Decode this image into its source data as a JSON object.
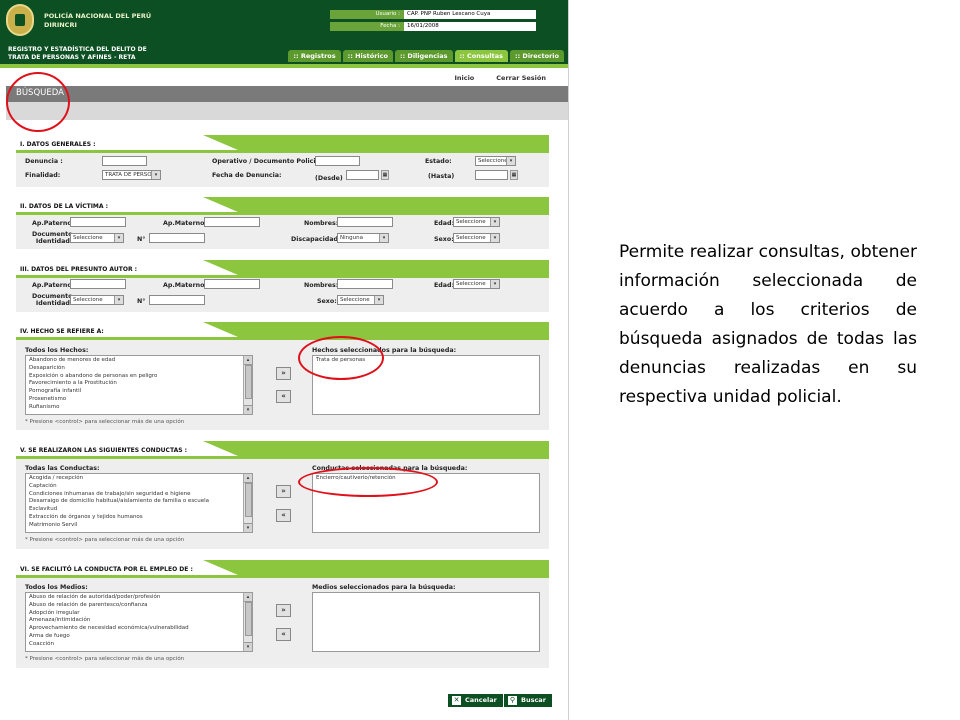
{
  "header": {
    "org_line1": "POLICÍA NACIONAL DEL PERÚ",
    "org_line2": "DIRINCRI",
    "user_label": "Usuario :",
    "user_value": "CAP. PNP Ruben Lescano Cuya",
    "date_label": "Fecha :",
    "date_value": "16/01/2008"
  },
  "module": {
    "title_line1": "REGISTRO Y ESTADÍSTICA DEL DELITO DE",
    "title_line2": "TRATA DE PERSONAS Y AFINES - RETA"
  },
  "nav": {
    "tabs": [
      ":: Registros",
      ":: Histórico",
      ":: Diligencias",
      ":: Consultas",
      ":: Directorio"
    ],
    "active_tab": ":: Consultas",
    "inicio": "Inicio",
    "cerrar": "Cerrar Sesión"
  },
  "page_title": "BÚSQUEDA",
  "sec1": {
    "title": "I. DATOS GENERALES :",
    "denuncia_label": "Denuncia :",
    "operativo_label": "Operativo / Documento Policial:",
    "estado_label": "Estado:",
    "estado_value": "Seleccione",
    "finalidad_label": "Finalidad:",
    "finalidad_value": "TRATA DE PERSO",
    "fecha_label": "Fecha de Denuncia:",
    "desde_label": "(Desde)",
    "hasta_label": "(Hasta)"
  },
  "sec2": {
    "title": "II. DATOS DE LA VÍCTIMA :",
    "ap_paterno": "Ap.Paterno:",
    "ap_materno": "Ap.Materno:",
    "nombres": "Nombres:",
    "edad": "Edad:",
    "edad_value": "Seleccione",
    "doc_line1": "Documento",
    "doc_line2": "Identidad:",
    "doc_value": "Seleccione",
    "numero": "N°",
    "discapacidad": "Discapacidad:",
    "discapacidad_value": "Ninguna",
    "sexo": "Sexo:",
    "sexo_value": "Seleccione"
  },
  "sec3": {
    "title": "III. DATOS DEL PRESUNTO AUTOR :",
    "ap_paterno": "Ap.Paterno:",
    "ap_materno": "Ap.Materno:",
    "nombres": "Nombres:",
    "edad": "Edad:",
    "edad_value": "Seleccione",
    "doc_line1": "Documento",
    "doc_line2": "Identidad:",
    "doc_value": "Seleccione",
    "numero": "N°",
    "sexo": "Sexo:",
    "sexo_value": "Seleccione"
  },
  "sec4": {
    "title": "IV. HECHO SE REFIERE A:",
    "all_label": "Todos los Hechos:",
    "selected_label": "Hechos seleccionados para la búsqueda:",
    "items": [
      "Abandono de menores de edad",
      "Desaparición",
      "Exposición o abandono de personas en peligro",
      "Favorecimiento a la Prostitución",
      "Pornografía infantil",
      "Proxenetismo",
      "Rufianismo"
    ],
    "selected_items": [
      "Trata de personas"
    ],
    "note": "* Presione <control> para seleccionar más de una opción"
  },
  "sec5": {
    "title": "V. SE REALIZARON LAS SIGUIENTES CONDUCTAS :",
    "all_label": "Todas las Conductas:",
    "selected_label": "Conductas seleccionadas para la búsqueda:",
    "items": [
      "Acogida / recepción",
      "Captación",
      "Condiciones inhumanas de trabajo/sin seguridad e higiene",
      "Desarraigo de domicilio habitual/aislamiento de familia o escuela",
      "Esclavitud",
      "Extracción de órganos y tejidos humanos",
      "Matrimonio Servil"
    ],
    "selected_items": [
      "Encierro/cautiverio/retención"
    ],
    "note": "* Presione <control> para seleccionar más de una opción"
  },
  "sec6": {
    "title": "VI. SE FACILITÓ LA CONDUCTA POR EL EMPLEO DE :",
    "all_label": "Todos los Medios:",
    "selected_label": "Medios seleccionados para la búsqueda:",
    "items": [
      "Abuso de relación de autoridad/poder/profesión",
      "Abuso de relación de parentesco/confianza",
      "Adopción irregular",
      "Amenaza/intimidación",
      "Aprovechamiento de necesidad económica/vulnerabilidad",
      "Arma de fuego",
      "Coacción"
    ],
    "selected_items": [],
    "note": "* Presione <control> para seleccionar más de una opción"
  },
  "buttons": {
    "add": "»",
    "remove": "«",
    "cancel": "Cancelar",
    "search": "Buscar"
  },
  "description": "Permite realizar consultas, obtener información seleccionada de acuerdo a los criterios de búsqueda asignados de todas las denuncias realizadas en su respectiva unidad policial.",
  "colors": {
    "dark_green": "#0c4f22",
    "accent_green": "#8cc63f",
    "highlight_red": "#e0101a"
  }
}
